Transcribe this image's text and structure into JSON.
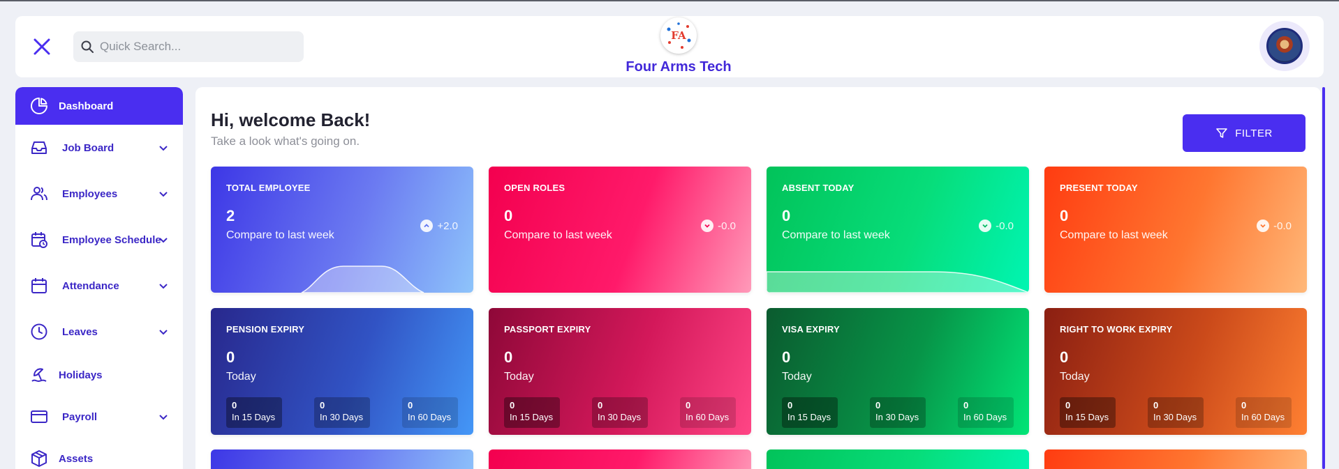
{
  "header": {
    "search_placeholder": "Quick Search...",
    "brand_name": "Four Arms Tech",
    "brand_logo_text": "FA"
  },
  "sidebar": {
    "items": [
      {
        "label": "Dashboard",
        "icon": "pie-chart-icon",
        "active": true,
        "expandable": false
      },
      {
        "label": "Job Board",
        "icon": "inbox-icon",
        "expandable": true
      },
      {
        "label": "Employees",
        "icon": "users-icon",
        "expandable": true
      },
      {
        "label": "Employee Schedule",
        "icon": "calendar-clock-icon",
        "expandable": true
      },
      {
        "label": "Attendance",
        "icon": "calendar-icon",
        "expandable": true
      },
      {
        "label": "Leaves",
        "icon": "clock-icon",
        "expandable": true
      },
      {
        "label": "Holidays",
        "icon": "beach-icon",
        "expandable": false
      },
      {
        "label": "Payroll",
        "icon": "credit-card-icon",
        "expandable": true
      },
      {
        "label": "Assets",
        "icon": "package-icon",
        "expandable": false
      }
    ]
  },
  "main": {
    "welcome_title": "Hi, welcome Back!",
    "welcome_subtitle": "Take a look what's going on.",
    "filter_label": "FILTER",
    "stat_cards": [
      {
        "title": "TOTAL EMPLOYEE",
        "value": "2",
        "subtitle": "Compare to last week",
        "trend": "+2.0",
        "trend_direction": "up"
      },
      {
        "title": "OPEN ROLES",
        "value": "0",
        "subtitle": "Compare to last week",
        "trend": "-0.0",
        "trend_direction": "down"
      },
      {
        "title": "ABSENT TODAY",
        "value": "0",
        "subtitle": "Compare to last week",
        "trend": "-0.0",
        "trend_direction": "down"
      },
      {
        "title": "PRESENT TODAY",
        "value": "0",
        "subtitle": "Compare to last week",
        "trend": "-0.0",
        "trend_direction": "down"
      }
    ],
    "expiry_cards": [
      {
        "title": "PENSION EXPIRY",
        "value": "0",
        "subtitle": "Today",
        "periods": [
          {
            "value": "0",
            "label": "In 15 Days"
          },
          {
            "value": "0",
            "label": "In 30 Days"
          },
          {
            "value": "0",
            "label": "In 60 Days"
          }
        ]
      },
      {
        "title": "PASSPORT EXPIRY",
        "value": "0",
        "subtitle": "Today",
        "periods": [
          {
            "value": "0",
            "label": "In 15 Days"
          },
          {
            "value": "0",
            "label": "In 30 Days"
          },
          {
            "value": "0",
            "label": "In 60 Days"
          }
        ]
      },
      {
        "title": "VISA EXPIRY",
        "value": "0",
        "subtitle": "Today",
        "periods": [
          {
            "value": "0",
            "label": "In 15 Days"
          },
          {
            "value": "0",
            "label": "In 30 Days"
          },
          {
            "value": "0",
            "label": "In 60 Days"
          }
        ]
      },
      {
        "title": "RIGHT TO WORK EXPIRY",
        "value": "0",
        "subtitle": "Today",
        "periods": [
          {
            "value": "0",
            "label": "In 15 Days"
          },
          {
            "value": "0",
            "label": "In 30 Days"
          },
          {
            "value": "0",
            "label": "In 60 Days"
          }
        ]
      }
    ]
  },
  "colors": {
    "accent": "#4a2ef0",
    "brand_text": "#4229d9",
    "nav_text": "#3b27c6"
  }
}
